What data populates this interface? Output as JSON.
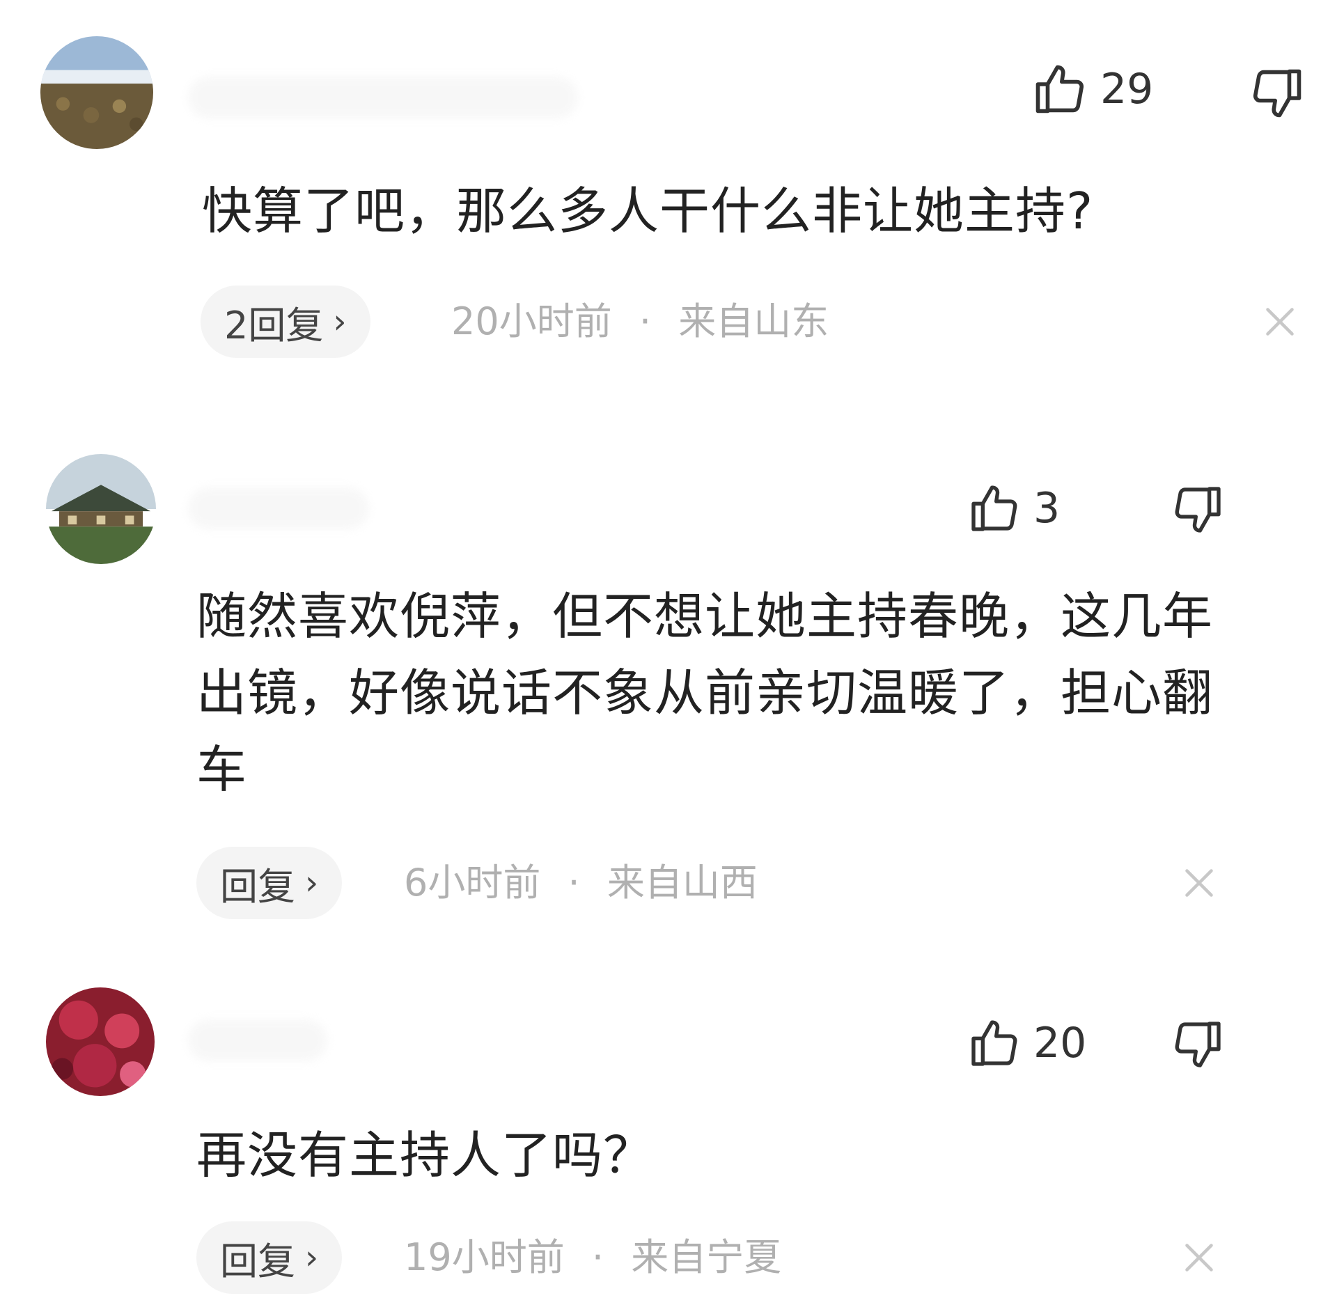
{
  "comments": [
    {
      "likes": "29",
      "text": "快算了吧，那么多人干什么非让她主持?",
      "replies_label": "2回复",
      "time": "20小时前",
      "separator": "·",
      "location": "来自山东"
    },
    {
      "likes": "3",
      "text": "随然喜欢倪萍，但不想让她主持春晚，这几年出镜，好像说话不象从前亲切温暖了，担心翻车",
      "replies_label": "回复",
      "time": "6小时前",
      "separator": "·",
      "location": "来自山西"
    },
    {
      "likes": "20",
      "text": "再没有主持人了吗？",
      "replies_label": "回复",
      "time": "19小时前",
      "separator": "·",
      "location": "来自宁夏"
    }
  ],
  "icons": {
    "like": "thumb-up-icon",
    "dislike": "thumb-down-icon",
    "chevron": "chevron-right-icon",
    "close": "close-icon"
  },
  "colors": {
    "text": "#222222",
    "meta": "#b0b0b0",
    "pill_bg": "#f4f4f4",
    "icon": "#333333"
  }
}
